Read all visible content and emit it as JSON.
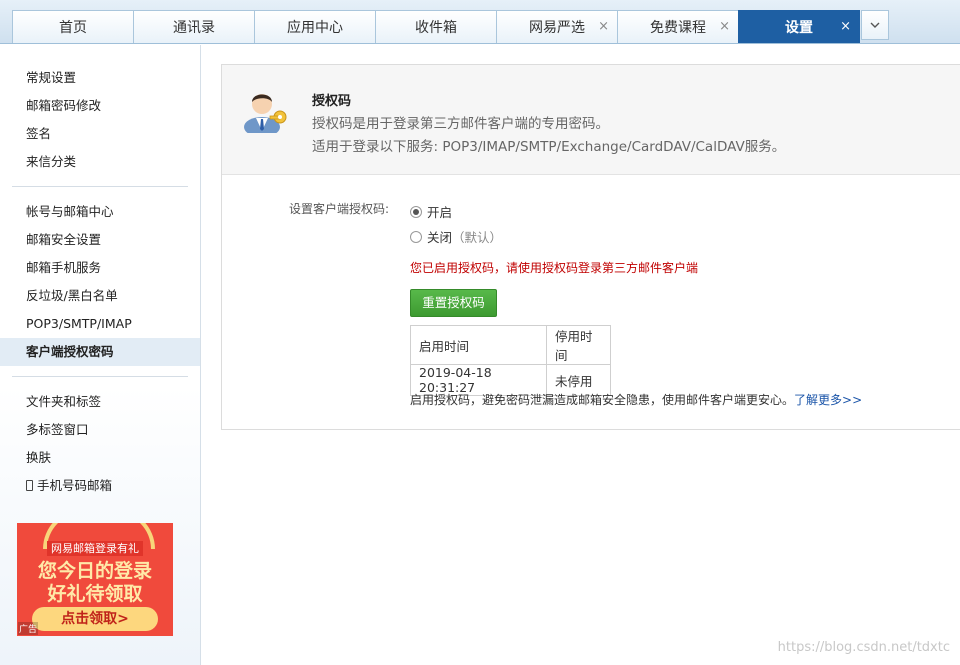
{
  "tabs": [
    {
      "label": "首页",
      "close": ""
    },
    {
      "label": "通讯录",
      "close": ""
    },
    {
      "label": "应用中心",
      "close": ""
    },
    {
      "label": "收件箱",
      "close": ""
    },
    {
      "label": "网易严选",
      "close": "×"
    },
    {
      "label": "免费课程",
      "close": "×"
    },
    {
      "label": "设置",
      "close": "×"
    }
  ],
  "sidebar": {
    "group1": [
      "常规设置",
      "邮箱密码修改",
      "签名",
      "来信分类"
    ],
    "group2": [
      "帐号与邮箱中心",
      "邮箱安全设置",
      "邮箱手机服务",
      "反垃圾/黑白名单",
      "POP3/SMTP/IMAP",
      "客户端授权密码"
    ],
    "group3": [
      "文件夹和标签",
      "多标签窗口",
      "换肤",
      "手机号码邮箱"
    ]
  },
  "ad": {
    "top": "网易邮箱登录有礼",
    "line1": "您今日的登录",
    "line2": "好礼待领取",
    "button": "点击领取>",
    "tag": "广告"
  },
  "panel": {
    "title": "授权码",
    "desc": "授权码是用于登录第三方邮件客户端的专用密码。",
    "desc2": "适用于登录以下服务: POP3/IMAP/SMTP/Exchange/CardDAV/CalDAV服务。",
    "field_label": "设置客户端授权码:",
    "option_on": "开启",
    "option_off": "关闭",
    "option_off_note": "（默认）",
    "notice": "您已启用授权码，请使用授权码登录第三方邮件客户端",
    "reset_button": "重置授权码",
    "table_headers": [
      "启用时间",
      "停用时间"
    ],
    "table_row": [
      "2019-04-18 20:31:27",
      "未停用"
    ],
    "tip": "启用授权码，避免密码泄漏造成邮箱安全隐患，使用邮件客户端更安心。",
    "learn_more": "了解更多>>"
  },
  "watermark": "https://blog.csdn.net/tdxtc"
}
